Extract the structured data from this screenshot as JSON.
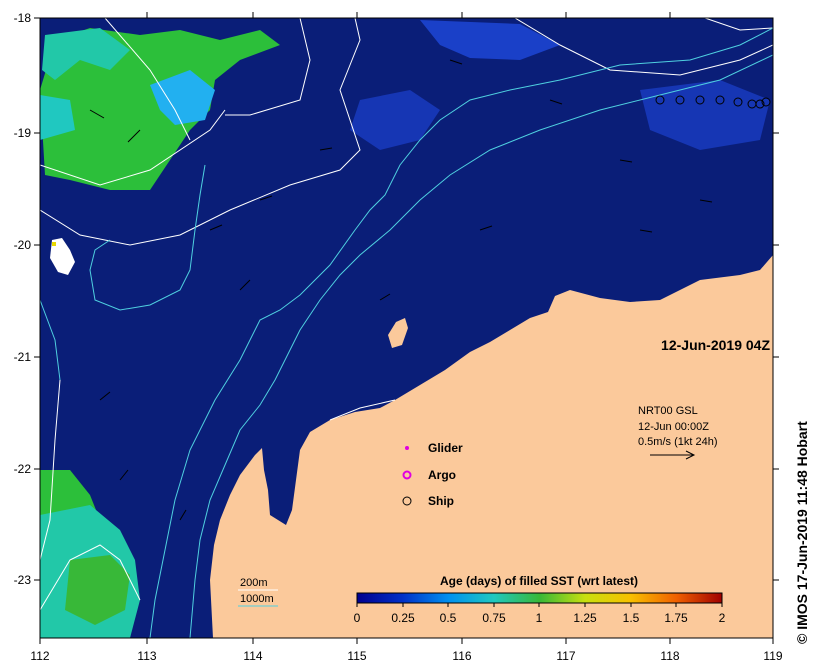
{
  "map": {
    "date_label": "12-Jun-2019 04Z",
    "credit": "© IMOS 17-Jun-2019 11:48 Hobart",
    "x_ticks": [
      "112",
      "113",
      "114",
      "115",
      "116",
      "117",
      "118",
      "119"
    ],
    "y_ticks": [
      "-18",
      "-19",
      "-20",
      "-21",
      "-22",
      "-23"
    ],
    "land_color": "#fbc99b",
    "ocean_color": "#0a1e78"
  },
  "current_vector": {
    "lines": [
      "NRT00 GSL",
      "12-Jun 00:00Z",
      "0.5m/s (1kt 24h)"
    ]
  },
  "markers": {
    "glider": "Glider",
    "argo": "Argo",
    "ship": "Ship"
  },
  "bathymetry": {
    "label_200": "200m",
    "label_1000": "1000m",
    "color_200": "#ffffff",
    "color_1000": "#4fd0e0"
  },
  "colorbar": {
    "title": "Age (days) of filled SST (wrt latest)",
    "ticks": [
      "0",
      "0.25",
      "0.5",
      "0.75",
      "1",
      "1.25",
      "1.5",
      "1.75",
      "2"
    ]
  }
}
